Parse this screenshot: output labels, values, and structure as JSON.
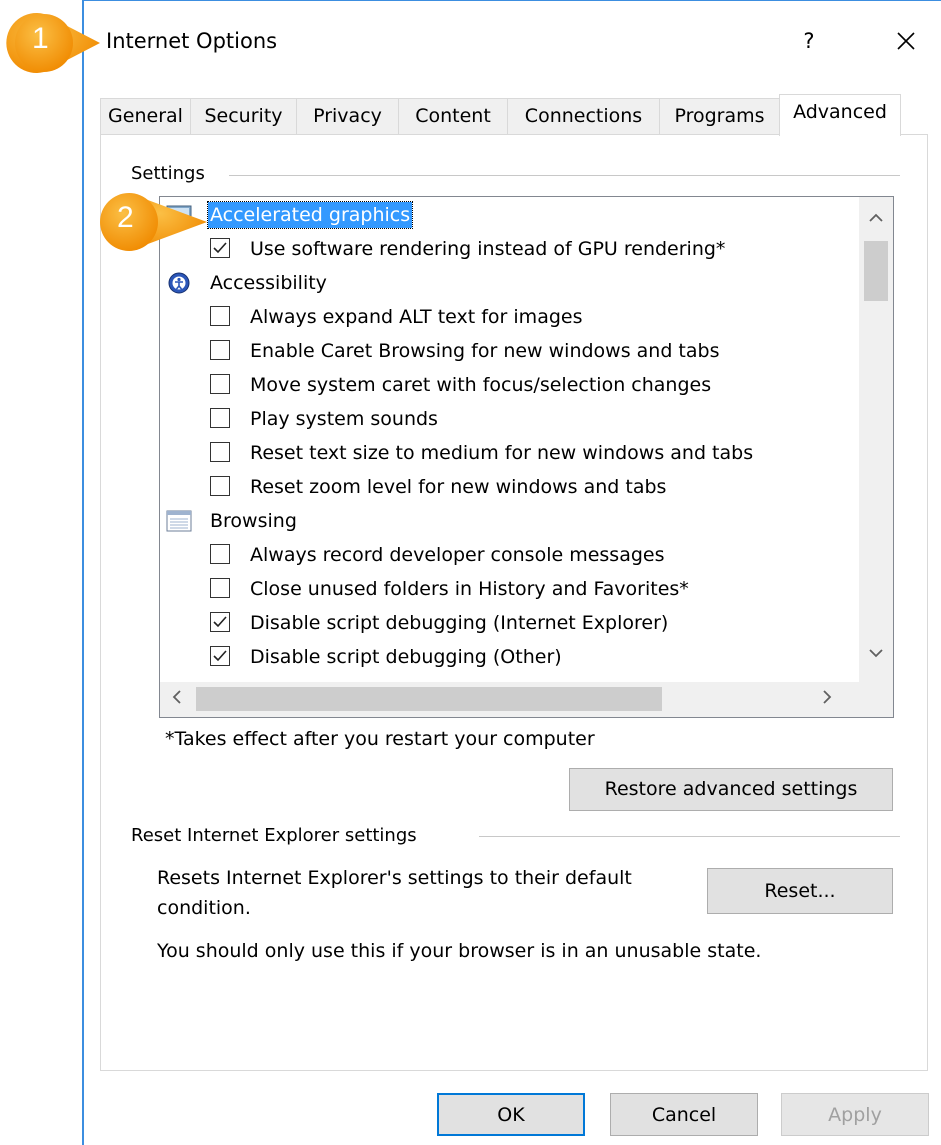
{
  "window": {
    "title": "Internet Options",
    "help_label": "?",
    "close_label": "✕"
  },
  "tabs": [
    {
      "label": "General"
    },
    {
      "label": "Security"
    },
    {
      "label": "Privacy"
    },
    {
      "label": "Content"
    },
    {
      "label": "Connections"
    },
    {
      "label": "Programs"
    },
    {
      "label": "Advanced",
      "active": true
    }
  ],
  "settings": {
    "group_label": "Settings",
    "categories": {
      "accelerated": "Accelerated graphics",
      "accessibility": "Accessibility",
      "browsing": "Browsing"
    },
    "options": {
      "software_rendering": {
        "label": "Use software rendering instead of GPU rendering*",
        "checked": true
      },
      "alt_text": {
        "label": "Always expand ALT text for images",
        "checked": false
      },
      "caret_browsing": {
        "label": "Enable Caret Browsing for new windows and tabs",
        "checked": false
      },
      "system_caret": {
        "label": "Move system caret with focus/selection changes",
        "checked": false
      },
      "system_sounds": {
        "label": "Play system sounds",
        "checked": false
      },
      "reset_text_size": {
        "label": "Reset text size to medium for new windows and tabs",
        "checked": false
      },
      "reset_zoom": {
        "label": "Reset zoom level for new windows and tabs",
        "checked": false
      },
      "dev_console": {
        "label": "Always record developer console messages",
        "checked": false
      },
      "close_folders": {
        "label": "Close unused folders in History and Favorites*",
        "checked": false
      },
      "debug_ie": {
        "label": "Disable script debugging (Internet Explorer)",
        "checked": true
      },
      "debug_other": {
        "label": "Disable script debugging (Other)",
        "checked": true
      }
    },
    "note": "*Takes effect after you restart your computer",
    "restore_label": "Restore advanced settings"
  },
  "reset_section": {
    "group_label": "Reset Internet Explorer settings",
    "description_line1": "Resets Internet Explorer's settings to their default",
    "description_line2": "condition.",
    "reset_label": "Reset...",
    "warning": "You should only use this if your browser is in an unusable state."
  },
  "footer": {
    "ok_label": "OK",
    "cancel_label": "Cancel",
    "apply_label": "Apply"
  },
  "callouts": [
    "1",
    "2"
  ],
  "colors": {
    "accent": "#0078d7",
    "selection": "#3399ff",
    "callout": "#f5a01a"
  }
}
